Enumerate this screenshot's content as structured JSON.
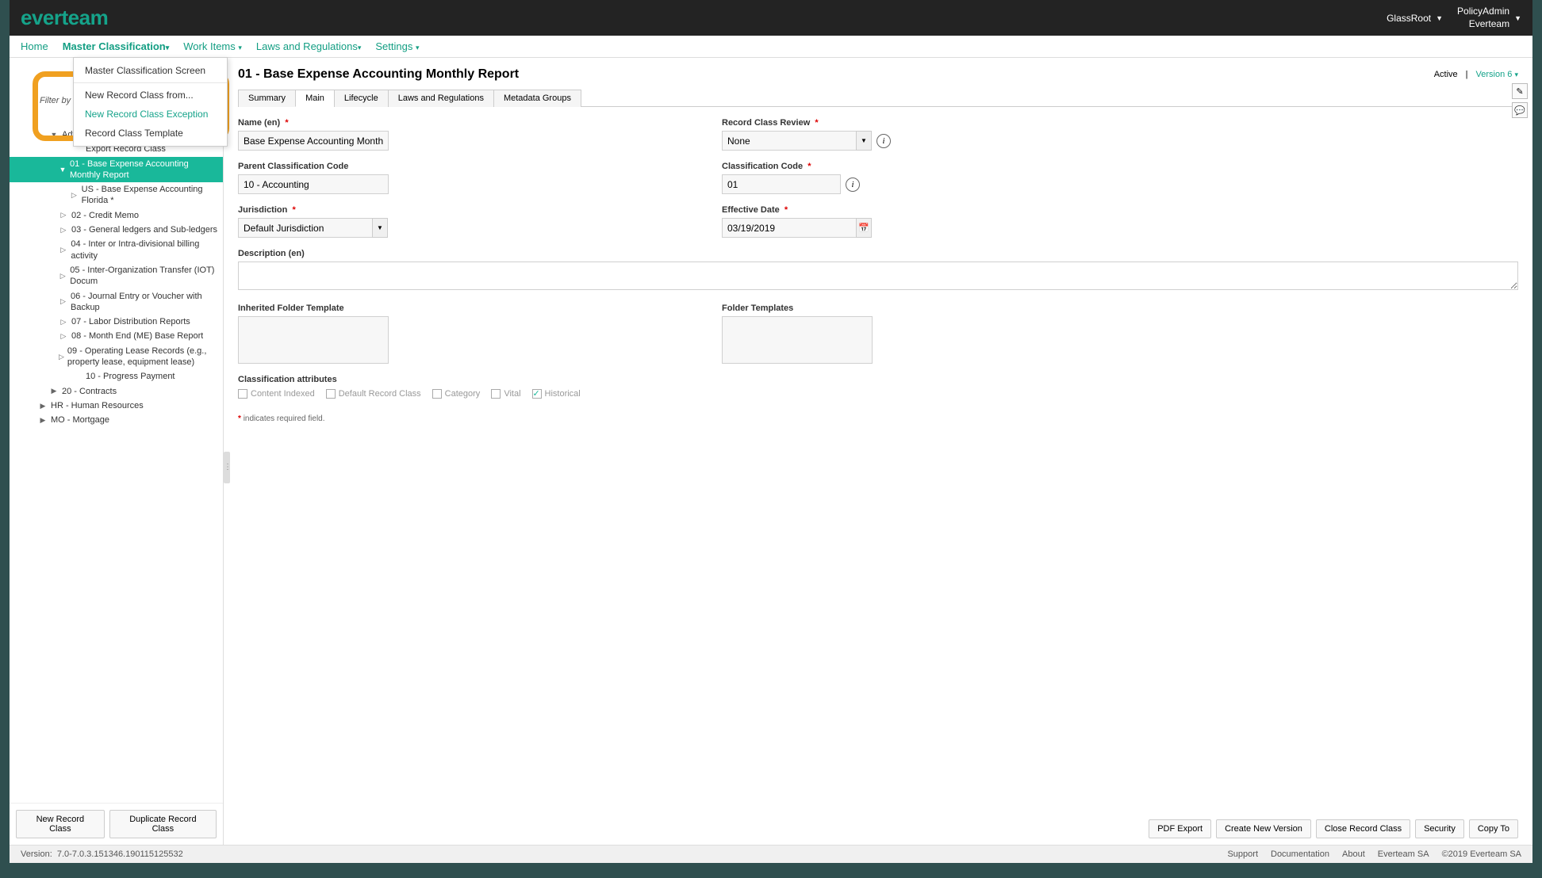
{
  "header": {
    "logo": "everteam",
    "user1": "GlassRoot",
    "user2_line1": "PolicyAdmin",
    "user2_line2": "Everteam"
  },
  "nav": {
    "home": "Home",
    "master": "Master Classification",
    "work": "Work Items",
    "laws": "Laws and Regulations",
    "settings": "Settings"
  },
  "dropdown": {
    "screen": "Master Classification Screen",
    "new_from": "New Record Class from...",
    "new_exception": "New Record Class Exception",
    "template": "Record Class Template"
  },
  "sidebar": {
    "filter_label": "Filter by",
    "adv_search": "Advanced Search",
    "export": "Export Record Class",
    "selected": "01 - Base Expense Accounting Monthly Report",
    "child1": "US - Base Expense Accounting Florida *",
    "n02": "02 - Credit Memo",
    "n03": "03 - General ledgers and Sub-ledgers",
    "n04": "04 - Inter or Intra-divisional billing activity",
    "n05": "05 - Inter-Organization Transfer (IOT) Docum",
    "n06": "06 - Journal Entry or Voucher with Backup",
    "n07": "07 - Labor Distribution Reports",
    "n08": "08 - Month End (ME) Base Report",
    "n09": "09 - Operating Lease Records (e.g., property lease, equipment lease)",
    "n10": "10 - Progress Payment",
    "n20": "20 - Contracts",
    "hr": "HR - Human Resources",
    "mo": "MO - Mortgage",
    "btn_new": "New Record Class",
    "btn_dup": "Duplicate Record Class"
  },
  "content": {
    "title": "01 - Base Expense Accounting Monthly Report",
    "status": "Active",
    "version": "Version 6",
    "tabs": {
      "summary": "Summary",
      "main": "Main",
      "lifecycle": "Lifecycle",
      "laws": "Laws and Regulations",
      "meta": "Metadata Groups"
    },
    "form": {
      "name_label": "Name (en)",
      "name_value": "Base Expense Accounting Monthly Rep",
      "review_label": "Record Class Review",
      "review_value": "None",
      "parent_label": "Parent Classification Code",
      "parent_value": "10 - Accounting",
      "classcode_label": "Classification Code",
      "classcode_value": "01",
      "juris_label": "Jurisdiction",
      "juris_value": "Default Jurisdiction",
      "eff_label": "Effective Date",
      "eff_value": "03/19/2019",
      "desc_label": "Description (en)",
      "inh_template_label": "Inherited Folder Template",
      "folder_template_label": "Folder Templates",
      "attr_label": "Classification attributes",
      "chk_indexed": "Content Indexed",
      "chk_default": "Default Record Class",
      "chk_category": "Category",
      "chk_vital": "Vital",
      "chk_historical": "Historical",
      "req_note": "indicates required field."
    },
    "footer_buttons": {
      "pdf": "PDF Export",
      "create": "Create New Version",
      "close": "Close Record Class",
      "security": "Security",
      "copy": "Copy To"
    }
  },
  "status_bar": {
    "version_label": "Version:",
    "version_val": "7.0-7.0.3.151346.190115125532",
    "support": "Support",
    "docs": "Documentation",
    "about": "About",
    "company": "Everteam SA",
    "copyright": "©2019 Everteam SA"
  }
}
